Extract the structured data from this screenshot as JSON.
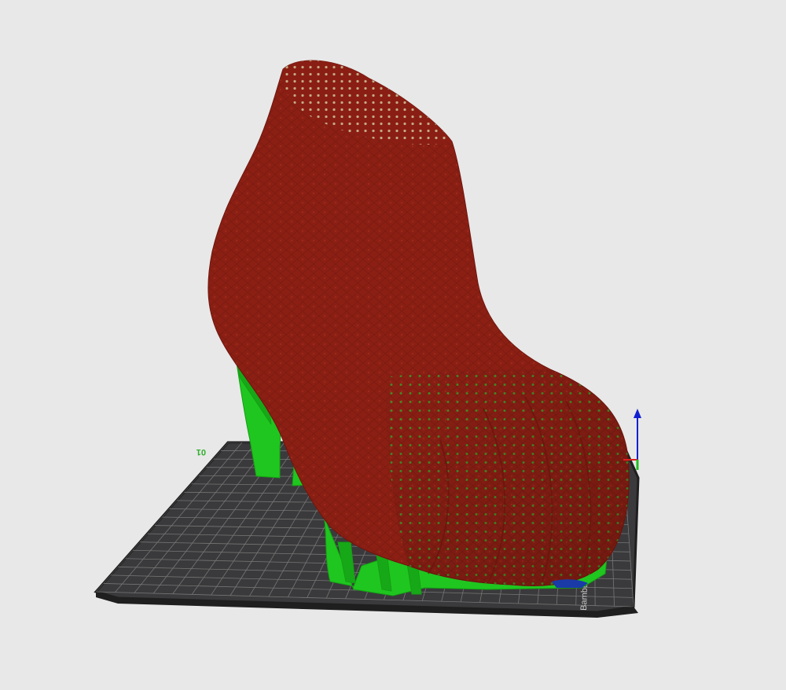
{
  "viewport": {
    "background_color": "#e8e8e8"
  },
  "build_plate": {
    "plate_number": "01",
    "brand_label": "Bambu Textured",
    "plate_color": "#3a3a3c",
    "grid_color": "#8a8a8a",
    "edge_color": "#1f1f1f"
  },
  "model": {
    "object": "high heel shoe",
    "model_color": "#8b1f14",
    "highlight_color": "#d9d2a8",
    "support_color": "#1fc61f"
  },
  "axes": {
    "x_color": "#e02020",
    "y_color": "#20c020",
    "z_color": "#1020d0"
  }
}
